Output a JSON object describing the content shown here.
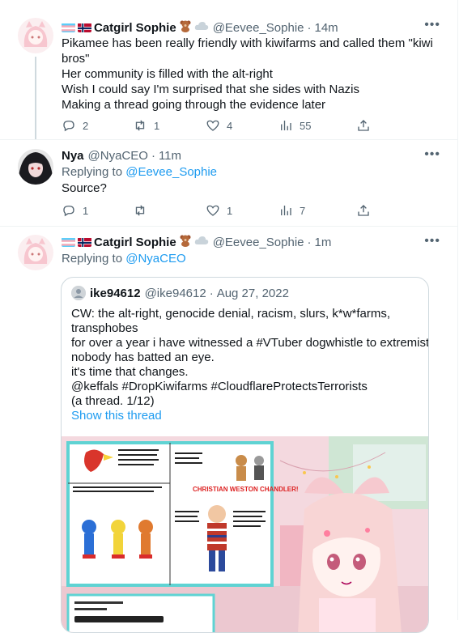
{
  "tweets": [
    {
      "name": "Catgirl Sophie",
      "handle": "@Eevee_Sophie",
      "time": "14m",
      "lines": [
        "Pikamee has been really friendly with kiwifarms and called them \"kiwi",
        "bros\"",
        "Her community is filled with the alt-right",
        "Wish I could say I'm surprised that she sides with Nazis",
        "Making a thread going through the evidence later"
      ],
      "replies": "2",
      "retweets": "1",
      "likes": "4",
      "views": "55"
    },
    {
      "name": "Nya",
      "handle": "@NyaCEO",
      "time": "11m",
      "replying_prefix": "Replying to",
      "replying_to": "@Eevee_Sophie",
      "text": "Source?",
      "replies": "1",
      "retweets": "",
      "likes": "1",
      "views": "7"
    },
    {
      "name": "Catgirl Sophie",
      "handle": "@Eevee_Sophie",
      "time": "1m",
      "replying_prefix": "Replying to",
      "replying_to": "@NyaCEO"
    }
  ],
  "quote": {
    "name": "ike94612",
    "handle": "@ike94612",
    "date": "Aug 27, 2022",
    "lines": [
      "CW: the alt-right, genocide denial, racism, slurs, k*w*farms,",
      "transphobes",
      "for over a year i have witnessed a #VTuber dogwhistle to extremists.",
      "nobody has batted an eye.",
      "it's time that changes.",
      "@keffals #DropKiwifarms #CloudflareProtectsTerrorists",
      "(a thread. 1/12)"
    ],
    "show_thread": "Show this thread",
    "media_heading": "CHRISTIAN WESTON CHANDLER!"
  },
  "icons": {
    "more": "more-dots-icon",
    "reply": "reply-icon",
    "retweet": "retweet-icon",
    "like": "heart-icon",
    "views": "views-icon",
    "share": "share-icon"
  },
  "colors": {
    "link": "#1d9bf0",
    "muted": "#536471",
    "border": "#cfd9de"
  }
}
